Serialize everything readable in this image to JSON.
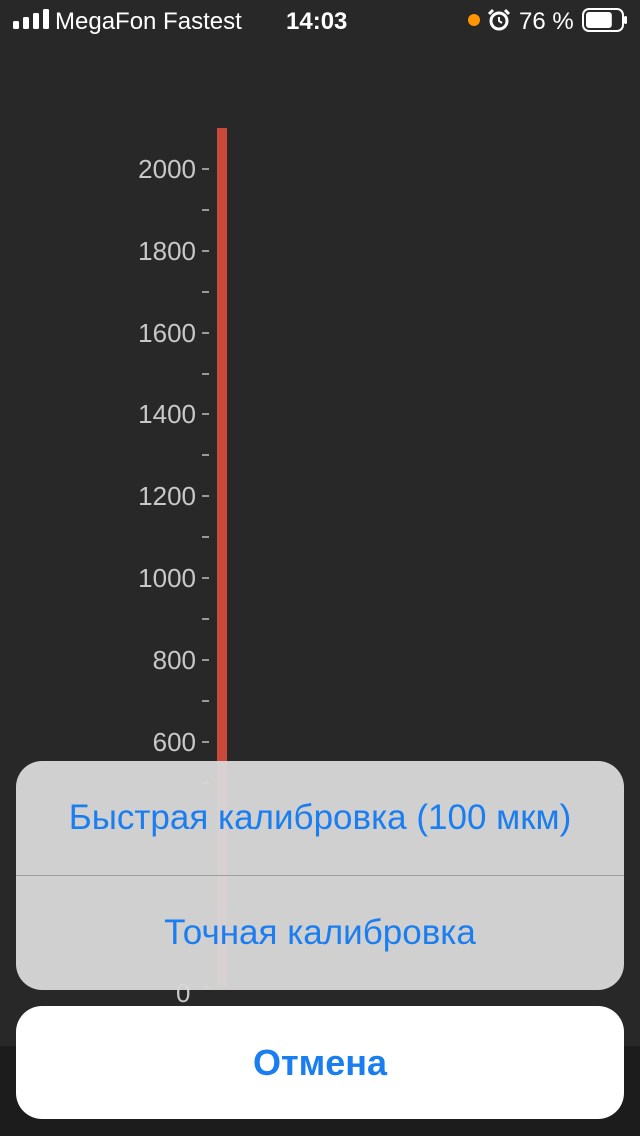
{
  "status_bar": {
    "carrier": "MegaFon Fastest",
    "time": "14:03",
    "battery_percent": "76 %",
    "signal_bars": 4,
    "battery_level": 0.76,
    "icons": [
      "signal-icon",
      "orange-dot-indicator",
      "alarm-icon",
      "battery-icon"
    ]
  },
  "chart_data": {
    "type": "bar",
    "categories": [
      ""
    ],
    "values": [
      2100
    ],
    "ylim": [
      0,
      2100
    ],
    "y_ticks": [
      0,
      600,
      800,
      1000,
      1200,
      1400,
      1600,
      1800,
      2000
    ],
    "y_tick_labels": [
      "0",
      "600",
      "800",
      "1000",
      "1200",
      "1400",
      "1600",
      "1800",
      "2000"
    ],
    "minor_tick_step": 100,
    "bar_color": "#c94a38",
    "grid": false,
    "title": "",
    "xlabel": "",
    "ylabel": ""
  },
  "action_sheet": {
    "options": [
      {
        "label": "Быстрая калибровка (100 мкм)"
      },
      {
        "label": "Точная калибровка"
      }
    ],
    "cancel_label": "Отмена",
    "accent_color": "#1a7ef0"
  }
}
